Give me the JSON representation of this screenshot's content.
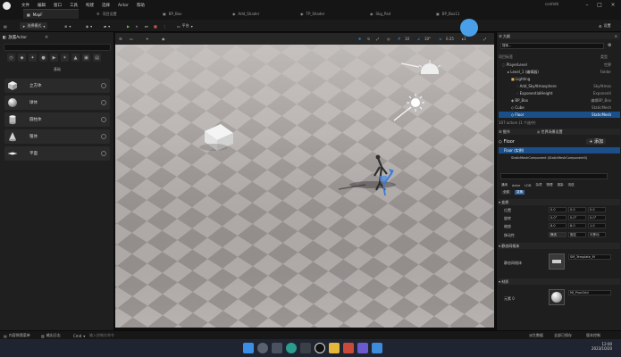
{
  "titlebar": {
    "menu": [
      "文件",
      "编辑",
      "窗口",
      "工具",
      "构建",
      "选择",
      "Actor",
      "帮助"
    ],
    "tabs": [
      "MapF",
      "项目设置",
      "BP_Box",
      "Add_Shader",
      "TP_Shader",
      "Skg_Pad",
      "BP_Box11"
    ],
    "active_tab_index": 0,
    "right_text": "confetti"
  },
  "toolbar": {
    "save_label": "",
    "mode_label": "选择模式",
    "platform_label": "平台",
    "settings_label": "设置"
  },
  "left_panel": {
    "tab_label": "放置Actor",
    "category_caption": "基础",
    "items": [
      {
        "label": "立方体",
        "icon": "cube-icon"
      },
      {
        "label": "球体",
        "icon": "sphere-icon"
      },
      {
        "label": "圆柱体",
        "icon": "cylinder-icon"
      },
      {
        "label": "锥体",
        "icon": "cone-icon"
      },
      {
        "label": "平面",
        "icon": "plane-icon"
      }
    ]
  },
  "viewport": {
    "toolbar_icons": [
      "move-icon",
      "rotate-icon",
      "scale-icon",
      "world-icon",
      "snap-icon",
      "grid-icon",
      "angle-icon",
      "scale-snap-icon",
      "camera-speed-icon",
      "maximize-icon"
    ],
    "snap_values": [
      "10",
      "10°",
      "0.25",
      "1"
    ]
  },
  "outliner": {
    "tab_label": "大纲",
    "search_placeholder": "搜索...",
    "header_label": "项目标签",
    "header_type": "类型",
    "rows": [
      {
        "label": "PlayerLevel",
        "type": "世界"
      },
      {
        "label": "Level_1 (编辑器)",
        "type": "Folder"
      },
      {
        "label": "Lighting",
        "type": ""
      },
      {
        "label": "Add_SkyAtmosphere",
        "type": "SkyAtmos"
      },
      {
        "label": "ExponentialHeight",
        "type": "Exponenti"
      },
      {
        "label": "BP_Box",
        "type": "编辑BP_Box"
      },
      {
        "label": "Cube",
        "type": "StaticMesh"
      },
      {
        "label": "Floor",
        "type": "StaticMesh"
      }
    ],
    "footer": "107 actors (1 个选中)"
  },
  "details": {
    "tab_label": "细节",
    "tab2_label": "世界场景设置",
    "actor_name": "Floor",
    "add_label": "+ 添加",
    "component_label": "Floor (实例)",
    "component_child": "StaticMeshComponent (StaticMeshComponent0)",
    "filters": [
      "通用",
      "Actor",
      "LOD",
      "杂项",
      "物理",
      "渲染",
      "流送",
      "所有"
    ],
    "subfilters": [
      "全部",
      "变换"
    ],
    "section_transform": "变换",
    "labels": [
      "位置",
      "旋转",
      "缩放",
      "移动性"
    ],
    "location": [
      "0.0",
      "0.0",
      "0.0"
    ],
    "rotation": [
      "0.0°",
      "0.0°",
      "0.0°"
    ],
    "scale": [
      "8.0",
      "8.0",
      "1.0"
    ],
    "mobility": [
      "静态",
      "固定",
      "可移动"
    ],
    "section_mesh": "静态网格体",
    "mesh_label": "静态网格体",
    "mesh_value": "SM_Template_M",
    "section_material": "材质",
    "material_label": "元素 0",
    "material_value": "MI_ProcGrid"
  },
  "statusbar": {
    "items": [
      "内容侧滑菜单",
      "输出日志",
      "Cmd",
      "输入控制台命令"
    ],
    "right": [
      "派生数据",
      "全部已保存",
      "版本控制"
    ]
  },
  "taskbar": {
    "time": "12:00",
    "date": "2023/10/20"
  }
}
